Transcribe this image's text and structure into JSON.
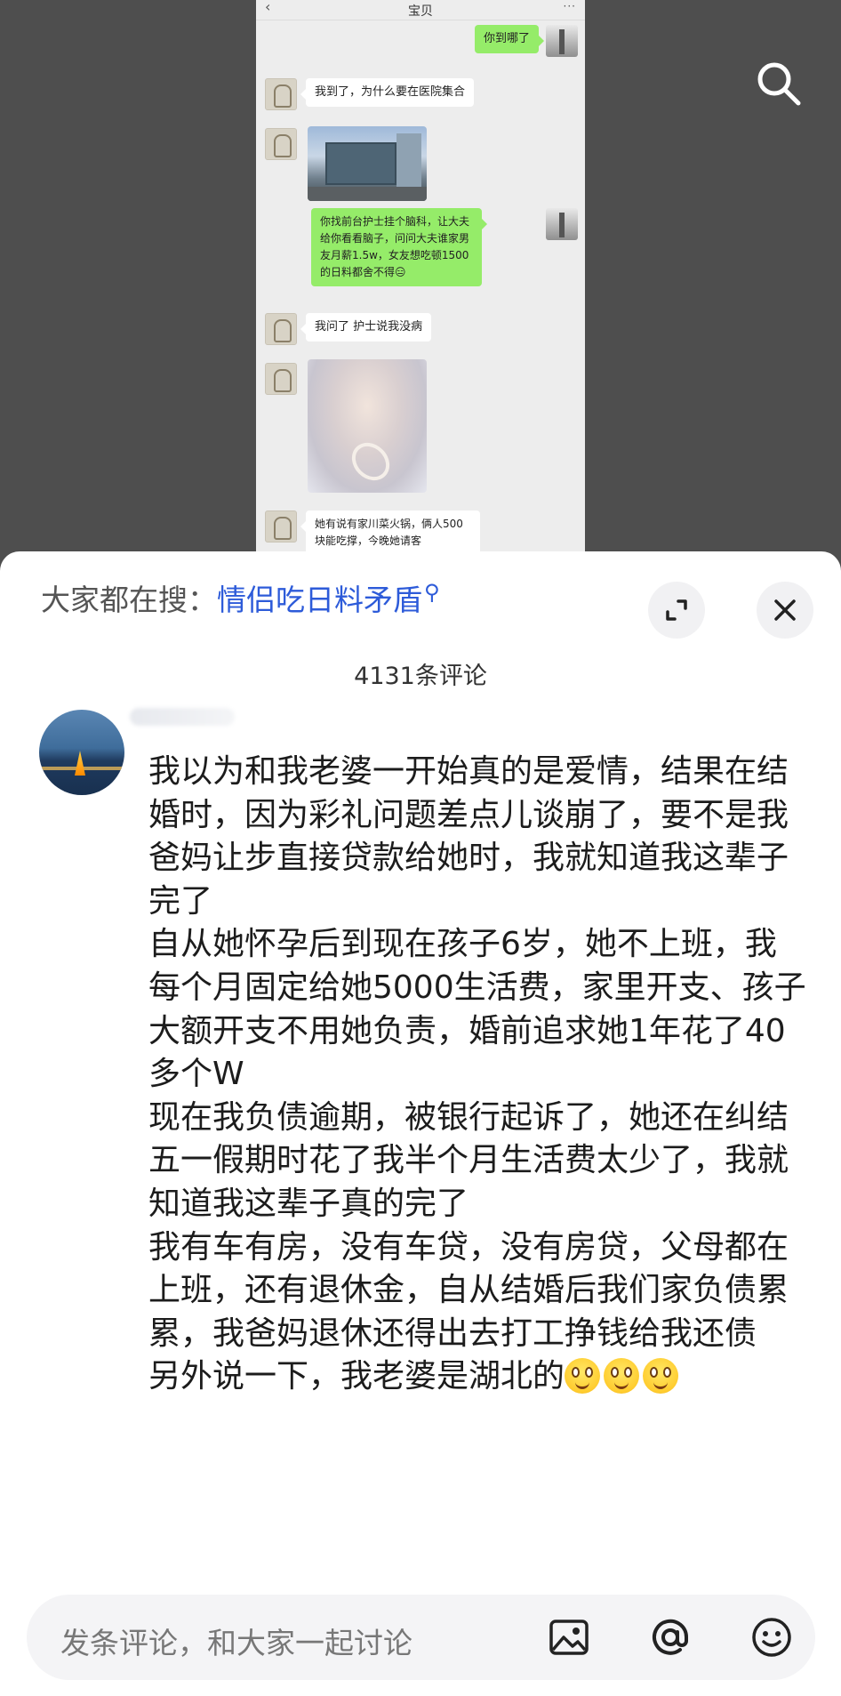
{
  "chat_preview": {
    "back_icon": "chevron-left-icon",
    "title": "宝贝",
    "messages": [
      {
        "side": "right",
        "text": "你到哪了"
      },
      {
        "side": "left",
        "text": "我到了，为什么要在医院集合"
      },
      {
        "side": "left",
        "type": "image",
        "desc_icon": "hospital-photo"
      },
      {
        "side": "right",
        "text": "你找前台护士挂个脑科，让大夫给你看看脑子，问问大夫谁家男友月薪1.5w，女友想吃顿1500的日料都舍不得😑"
      },
      {
        "side": "left",
        "text": "我问了 护士说我没病"
      },
      {
        "side": "left",
        "type": "image",
        "desc_icon": "blurred-selfie-photo"
      },
      {
        "side": "left",
        "text": "她有说有家川菜火锅，俩人500块能吃撑，今晚她请客"
      }
    ]
  },
  "search_button_icon": "search-icon",
  "panel": {
    "suggest_prefix": "大家都在搜：",
    "suggest_keyword": "情侣吃日料矛盾",
    "suggest_icon": "search-small-icon",
    "expand_icon": "expand-icon",
    "close_icon": "close-icon",
    "comment_count": "4131条评论"
  },
  "comment": {
    "paragraphs": [
      "我以为和我老婆一开始真的是爱情，结果在结婚时，因为彩礼问题差点儿谈崩了，要不是我爸妈让步直接贷款给她时，我就知道我这辈子完了",
      "自从她怀孕后到现在孩子6岁，她不上班，我每个月固定给她5000生活费，家里开支、孩子大额开支不用她负责，婚前追求她1年花了40多个W",
      "现在我负债逾期，被银行起诉了，她还在纠结五一假期时花了我半个月生活费太少了，我就知道我这辈子真的完了",
      "我有车有房，没有车贷，没有房贷，父母都在上班，还有退休金，自从结婚后我们家负债累累，我爸妈退休还得出去打工挣钱给我还债"
    ],
    "last_line": "另外说一下，我老婆是湖北的",
    "emoji_count": 3
  },
  "input_bar": {
    "placeholder": "发条评论，和大家一起讨论",
    "image_icon": "image-icon",
    "at_icon": "at-icon",
    "emoji_icon": "emoji-icon"
  },
  "colors": {
    "keyword": "#2d5bd9",
    "chat_green": "#95ec69",
    "background_grey": "#4e4e4e"
  }
}
